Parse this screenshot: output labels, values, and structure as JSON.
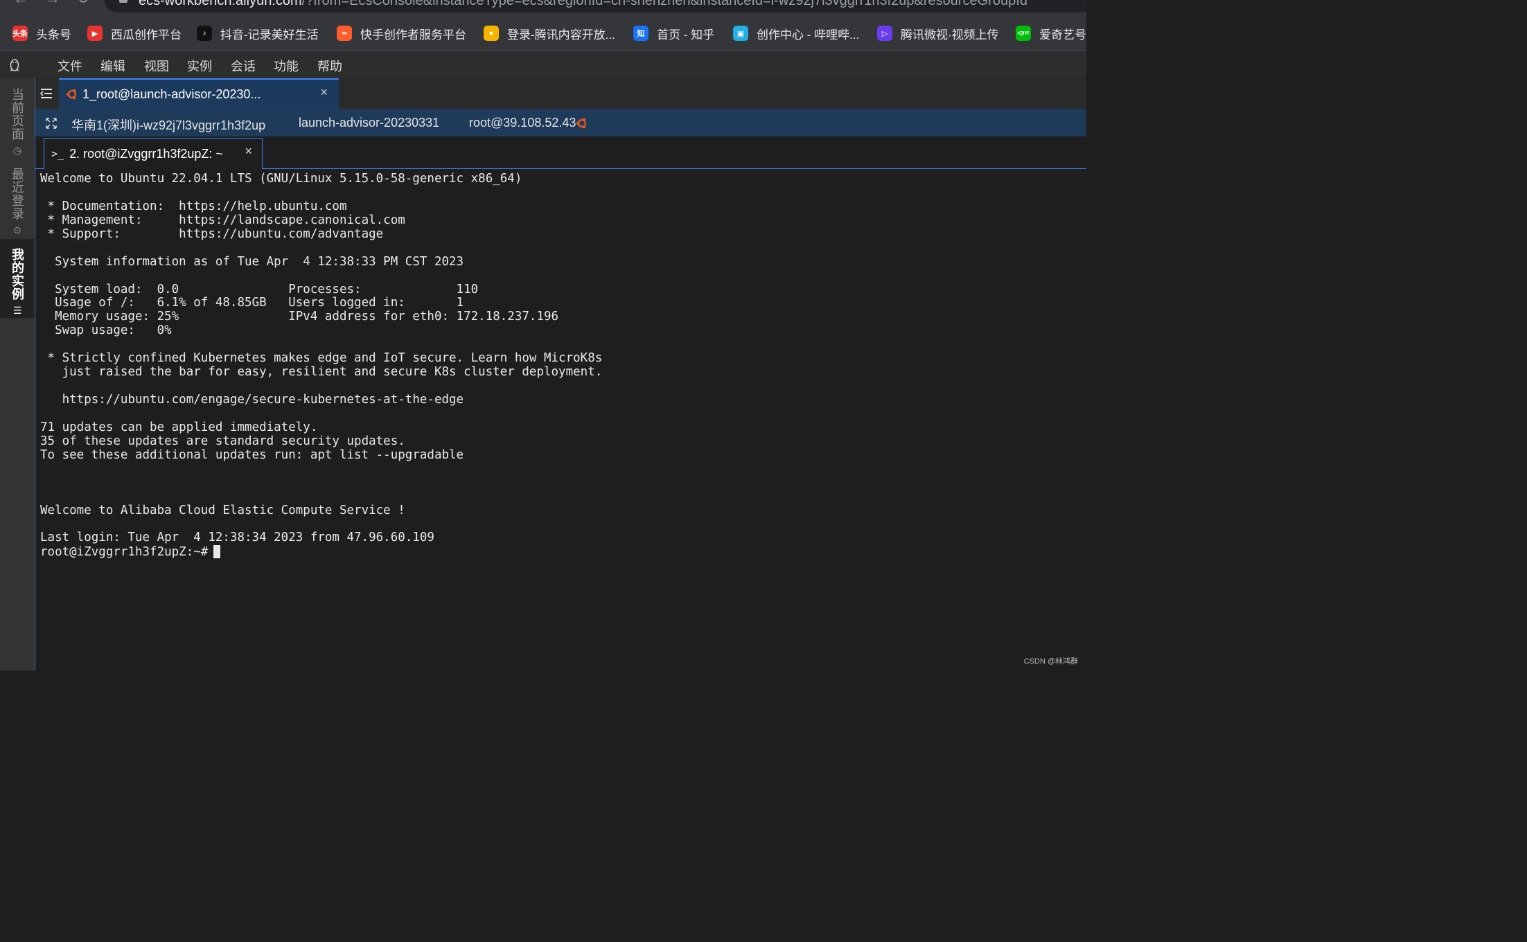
{
  "browser": {
    "url_host": "ecs-workbench.aliyun.com",
    "url_path": "/?from=EcsConsole&instanceType=ecs&regionId=cn-shenzhen&instanceId=i-wz92j7l3vggrr1h3f2up&resourceGroupId"
  },
  "bookmarks": [
    {
      "label": "头条号",
      "icon": "toutiao-icon",
      "color": "#e8322f",
      "glyph": "头条"
    },
    {
      "label": "西瓜创作平台",
      "icon": "xigua-icon",
      "color": "#e8322f",
      "glyph": "▶"
    },
    {
      "label": "抖音-记录美好生活",
      "icon": "douyin-icon",
      "color": "#111111",
      "glyph": "♪"
    },
    {
      "label": "快手创作者服务平台",
      "icon": "kuaishou-icon",
      "color": "#ff5a2a",
      "glyph": "∞"
    },
    {
      "label": "登录-腾讯内容开放...",
      "icon": "tencent-penguin-icon",
      "color": "#f4b400",
      "glyph": "●"
    },
    {
      "label": "首页 - 知乎",
      "icon": "zhihu-icon",
      "color": "#1772f6",
      "glyph": "知"
    },
    {
      "label": "创作中心 - 哔哩哔...",
      "icon": "bilibili-icon",
      "color": "#23ade5",
      "glyph": "▣"
    },
    {
      "label": "腾讯微视·视频上传",
      "icon": "weishi-icon",
      "color": "#6a3cf0",
      "glyph": "▷"
    },
    {
      "label": "爱奇艺号",
      "icon": "iqiyi-icon",
      "color": "#00be06",
      "glyph": "iQIYI"
    }
  ],
  "menu": [
    "文件",
    "编辑",
    "视图",
    "实例",
    "会话",
    "功能",
    "帮助"
  ],
  "left_rail": {
    "current_page": "当前页面",
    "recent_login": "最近登录",
    "my_instances": "我的实例"
  },
  "session_tab": {
    "label": "1_root@launch-advisor-20230...",
    "close": "×"
  },
  "info_bar": {
    "region_instance": "华南1(深圳)i-wz92j7l3vggrr1h3f2up",
    "instance_name": "launch-advisor-20230331",
    "login": "root@39.108.52.43"
  },
  "terminal_tab": {
    "label": "2. root@iZvggrr1h3f2upZ: ~",
    "close": "×"
  },
  "terminal": {
    "lines": [
      "Welcome to Ubuntu 22.04.1 LTS (GNU/Linux 5.15.0-58-generic x86_64)",
      "",
      " * Documentation:  https://help.ubuntu.com",
      " * Management:     https://landscape.canonical.com",
      " * Support:        https://ubuntu.com/advantage",
      "",
      "  System information as of Tue Apr  4 12:38:33 PM CST 2023",
      "",
      "  System load:  0.0               Processes:             110",
      "  Usage of /:   6.1% of 48.85GB   Users logged in:       1",
      "  Memory usage: 25%               IPv4 address for eth0: 172.18.237.196",
      "  Swap usage:   0%",
      "",
      " * Strictly confined Kubernetes makes edge and IoT secure. Learn how MicroK8s",
      "   just raised the bar for easy, resilient and secure K8s cluster deployment.",
      "",
      "   https://ubuntu.com/engage/secure-kubernetes-at-the-edge",
      "",
      "71 updates can be applied immediately.",
      "35 of these updates are standard security updates.",
      "To see these additional updates run: apt list --upgradable",
      "",
      "",
      "",
      "Welcome to Alibaba Cloud Elastic Compute Service !",
      "",
      "Last login: Tue Apr  4 12:38:34 2023 from 47.96.60.109"
    ],
    "prompt": "root@iZvggrr1h3f2upZ:~#"
  },
  "watermark": "CSDN @林鸿群"
}
